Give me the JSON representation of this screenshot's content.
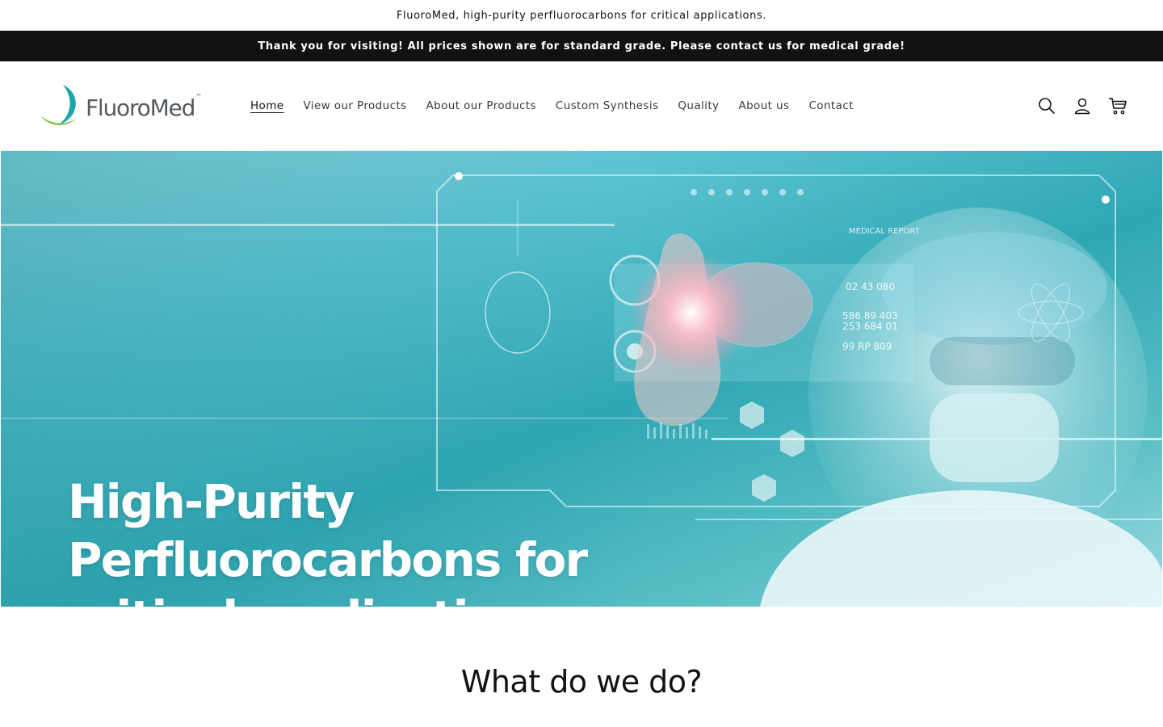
{
  "top_line": "FluoroMed, high-purity perfluorocarbons for critical applications.",
  "announcement": "Thank you for visiting! All prices shown are for standard grade. Please contact us for medical grade!",
  "logo": {
    "text": "FluoroMed",
    "tm": "™"
  },
  "nav": {
    "items": [
      {
        "label": "Home"
      },
      {
        "label": "View our Products"
      },
      {
        "label": "About our Products"
      },
      {
        "label": "Custom Synthesis"
      },
      {
        "label": "Quality"
      },
      {
        "label": "About us"
      },
      {
        "label": "Contact"
      }
    ]
  },
  "icons": {
    "search": "search-icon",
    "account": "user-icon",
    "cart": "cart-icon"
  },
  "hero": {
    "title_line1": "High-Purity",
    "title_line2": "Perfluorocarbons for",
    "title_line3": "critical applications.",
    "hud_text": {
      "medical_report": "MEDICAL REPORT",
      "num1": "02 43 080",
      "num2": "586 89 403",
      "num3": "253 684 01",
      "num4": "99 RP 809"
    }
  },
  "section": {
    "title": "What do we do?"
  },
  "colors": {
    "brand_green": "#7bbf44",
    "brand_teal": "#1aa7b0",
    "announcement_bg": "#121212"
  }
}
